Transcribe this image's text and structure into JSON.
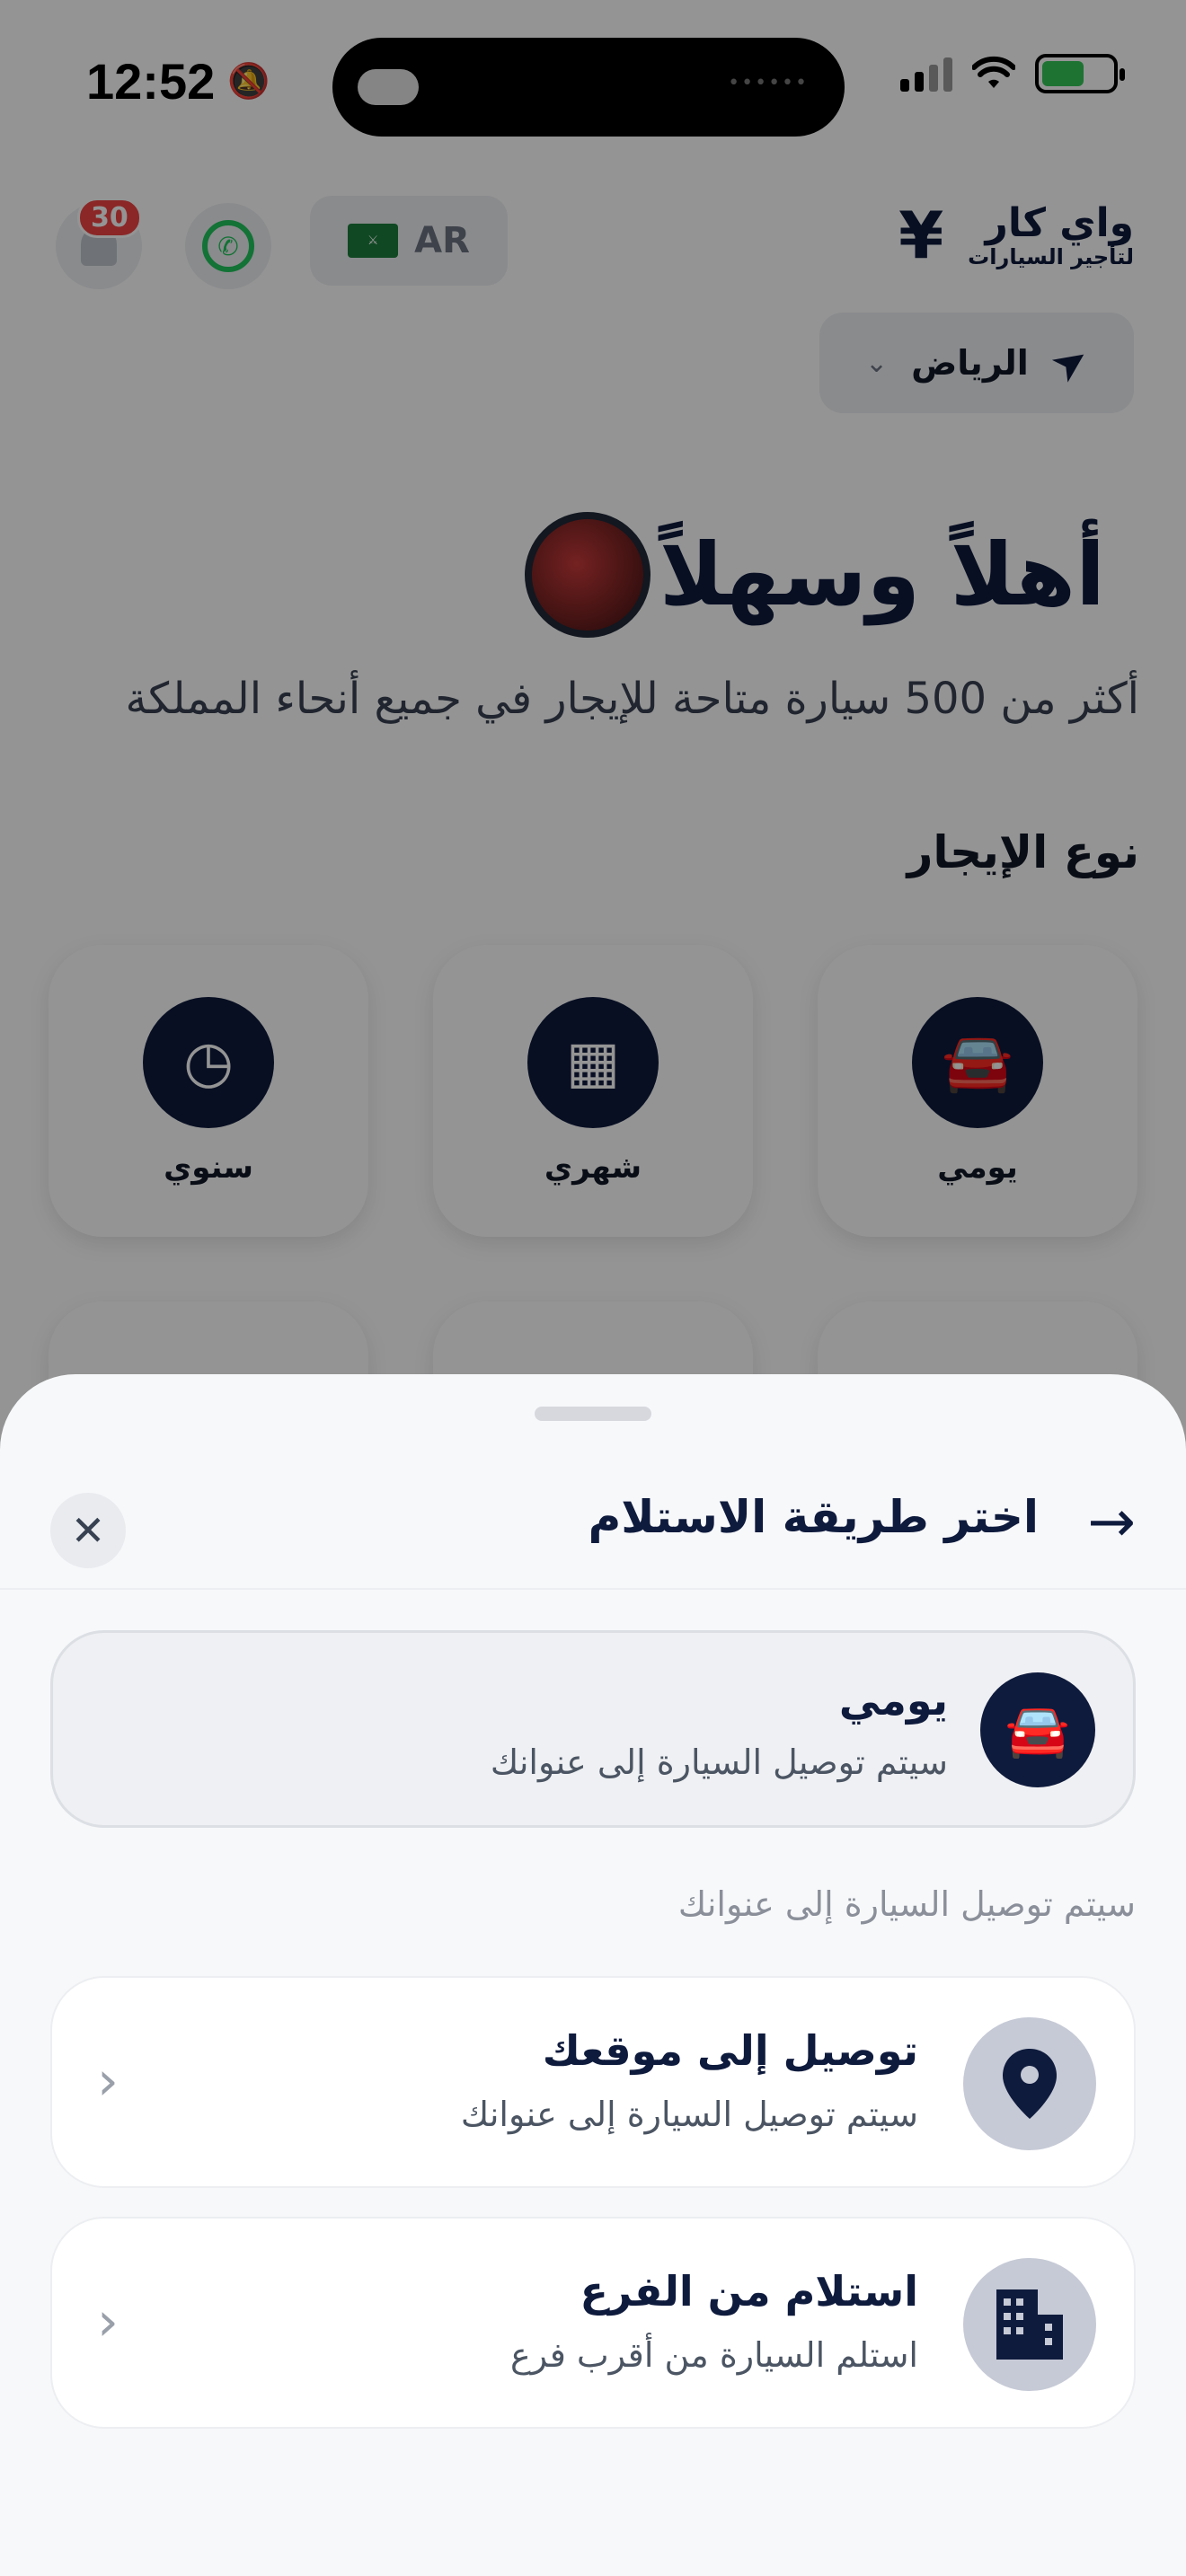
{
  "status_bar": {
    "time": "12:52"
  },
  "header": {
    "logo_line1": "واي كار",
    "logo_line2": "لتأجير السيارات",
    "language": "AR",
    "notification_count": "30",
    "city": "الرياض"
  },
  "welcome": {
    "title": "أهلاً وسهلاً",
    "subtitle": "أكثر من 500 سيارة متاحة للإيجار في جميع أنحاء المملكة"
  },
  "rental_types": {
    "title": "نوع الإيجار",
    "items": [
      {
        "label": "يومي",
        "icon": "car-icon"
      },
      {
        "label": "شهري",
        "icon": "calendar-icon"
      },
      {
        "label": "سنوي",
        "icon": "clock-icon"
      }
    ]
  },
  "sheet": {
    "title": "اختر طريقة الاستلام",
    "selected": {
      "title": "يومي",
      "subtitle": "سيتم توصيل السيارة إلى عنوانك"
    },
    "hint": "سيتم توصيل السيارة إلى عنوانك",
    "options": [
      {
        "title": "توصيل إلى موقعك",
        "subtitle": "سيتم توصيل السيارة إلى عنوانك",
        "icon": "location-pin-icon"
      },
      {
        "title": "استلام من الفرع",
        "subtitle": "استلم السيارة من أقرب فرع",
        "icon": "building-icon"
      }
    ]
  },
  "colors": {
    "primary": "#0f1b3d",
    "overlay": "rgba(0,0,0,0.42)",
    "badge": "#ef4444",
    "whatsapp": "#22c55e"
  }
}
